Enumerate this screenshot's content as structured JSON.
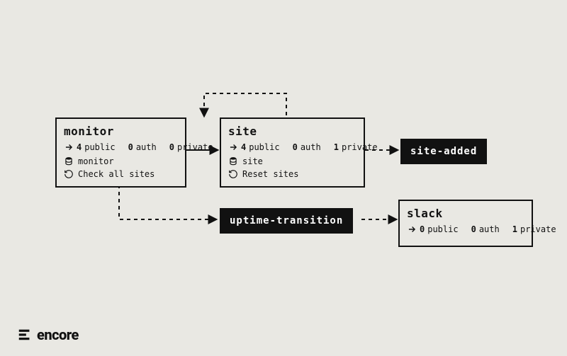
{
  "brand": {
    "name": "encore"
  },
  "labels": {
    "public": "public",
    "auth": "auth",
    "private": "private"
  },
  "nodes": {
    "monitor": {
      "title": "monitor",
      "public": "4",
      "auth": "0",
      "private": "0",
      "db": "monitor",
      "action": "Check all sites"
    },
    "site": {
      "title": "site",
      "public": "4",
      "auth": "0",
      "private": "1",
      "db": "site",
      "action": "Reset sites"
    },
    "slack": {
      "title": "slack",
      "public": "0",
      "auth": "0",
      "private": "1"
    }
  },
  "events": {
    "site_added": "site-added",
    "uptime_transition": "uptime-transition"
  },
  "chart_data": {
    "type": "diagram",
    "nodes": [
      {
        "id": "monitor",
        "kind": "service",
        "public": 4,
        "auth": 0,
        "private": 0,
        "db": "monitor",
        "cron": "Check all sites"
      },
      {
        "id": "site",
        "kind": "service",
        "public": 4,
        "auth": 0,
        "private": 1,
        "db": "site",
        "cron": "Reset sites"
      },
      {
        "id": "slack",
        "kind": "service",
        "public": 0,
        "auth": 0,
        "private": 1
      },
      {
        "id": "site-added",
        "kind": "event"
      },
      {
        "id": "uptime-transition",
        "kind": "event"
      }
    ],
    "edges": [
      {
        "from": "monitor",
        "to": "site",
        "style": "solid"
      },
      {
        "from": "site",
        "to": "monitor",
        "style": "dashed"
      },
      {
        "from": "site",
        "to": "site-added",
        "style": "dashed"
      },
      {
        "from": "monitor",
        "to": "uptime-transition",
        "style": "dashed"
      },
      {
        "from": "uptime-transition",
        "to": "slack",
        "style": "dashed"
      }
    ]
  }
}
